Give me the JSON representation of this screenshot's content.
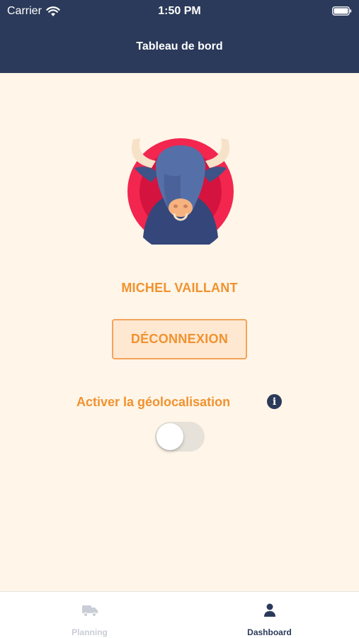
{
  "status_bar": {
    "carrier": "Carrier",
    "time": "1:50 PM",
    "icons": [
      "wifi-icon",
      "battery-icon"
    ]
  },
  "nav": {
    "title": "Tableau de bord"
  },
  "profile": {
    "avatar": "bull-avatar-icon",
    "name": "MICHEL VAILLANT",
    "logout_label": "DÉCONNEXION"
  },
  "geolocation": {
    "label": "Activer la géolocalisation",
    "info_icon": "i",
    "enabled": false
  },
  "tabbar": {
    "tabs": [
      {
        "label": "Planning",
        "icon": "truck-icon",
        "active": false
      },
      {
        "label": "Dashboard",
        "icon": "user-icon",
        "active": true
      }
    ]
  },
  "colors": {
    "header_bg": "#2b3a5a",
    "page_bg": "#fff5e8",
    "accent_orange": "#f0922f",
    "button_border": "#f2a35a",
    "button_bg": "#ffe8d2",
    "tab_inactive": "#c9cdd5",
    "tab_active": "#2b3a5a"
  }
}
